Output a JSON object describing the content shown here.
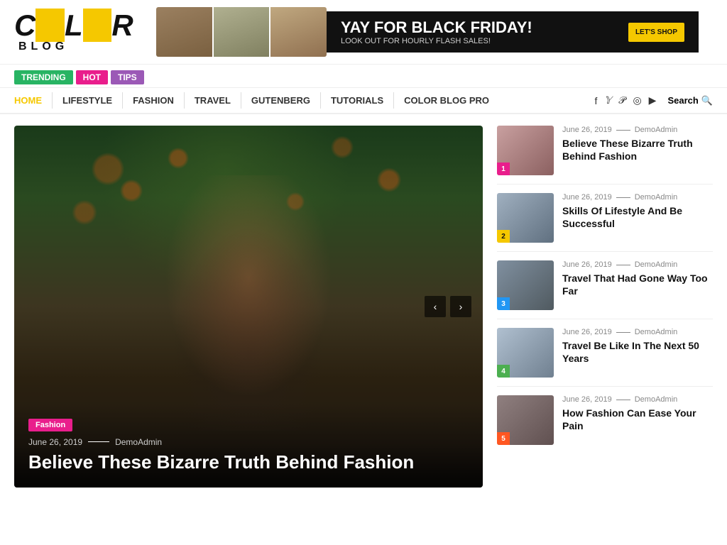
{
  "site": {
    "logo_color": "COLOR",
    "logo_blog": "BLOG"
  },
  "banner": {
    "headline": "YAY FOR BLACK FRIDAY!",
    "subtext": "LOOK OUT FOR HOURLY FLASH SALES!",
    "cta": "LET'S SHOP"
  },
  "tags": [
    {
      "label": "TRENDING",
      "class": "tag-trending"
    },
    {
      "label": "HOT",
      "class": "tag-hot"
    },
    {
      "label": "TIPS",
      "class": "tag-tips"
    }
  ],
  "nav": {
    "items": [
      {
        "label": "HOME",
        "active": true
      },
      {
        "label": "LIFESTYLE"
      },
      {
        "label": "FASHION"
      },
      {
        "label": "TRAVEL"
      },
      {
        "label": "GUTENBERG"
      },
      {
        "label": "TUTORIALS"
      },
      {
        "label": "COLOR BLOG PRO"
      }
    ],
    "search_label": "Search"
  },
  "hero": {
    "category": "Fashion",
    "date": "June 26, 2019",
    "author": "DemoAdmin",
    "title": "Believe These Bizarre Truth Behind Fashion",
    "prev_label": "‹",
    "next_label": "›"
  },
  "sidebar": {
    "items": [
      {
        "number": "1",
        "num_class": "num-1",
        "thumb_class": "thumb-1",
        "date": "June 26, 2019",
        "author": "DemoAdmin",
        "title": "Believe These Bizarre Truth Behind Fashion"
      },
      {
        "number": "2",
        "num_class": "num-2",
        "thumb_class": "thumb-2",
        "date": "June 26, 2019",
        "author": "DemoAdmin",
        "title": "Skills Of Lifestyle And Be Successful"
      },
      {
        "number": "3",
        "num_class": "num-3",
        "thumb_class": "thumb-3",
        "date": "June 26, 2019",
        "author": "DemoAdmin",
        "title": "Travel That Had Gone Way Too Far"
      },
      {
        "number": "4",
        "num_class": "num-4",
        "thumb_class": "thumb-4",
        "date": "June 26, 2019",
        "author": "DemoAdmin",
        "title": "Travel Be Like In The Next 50 Years"
      },
      {
        "number": "5",
        "num_class": "num-5",
        "thumb_class": "thumb-5",
        "date": "June 26, 2019",
        "author": "DemoAdmin",
        "title": "How Fashion Can Ease Your Pain"
      }
    ]
  }
}
